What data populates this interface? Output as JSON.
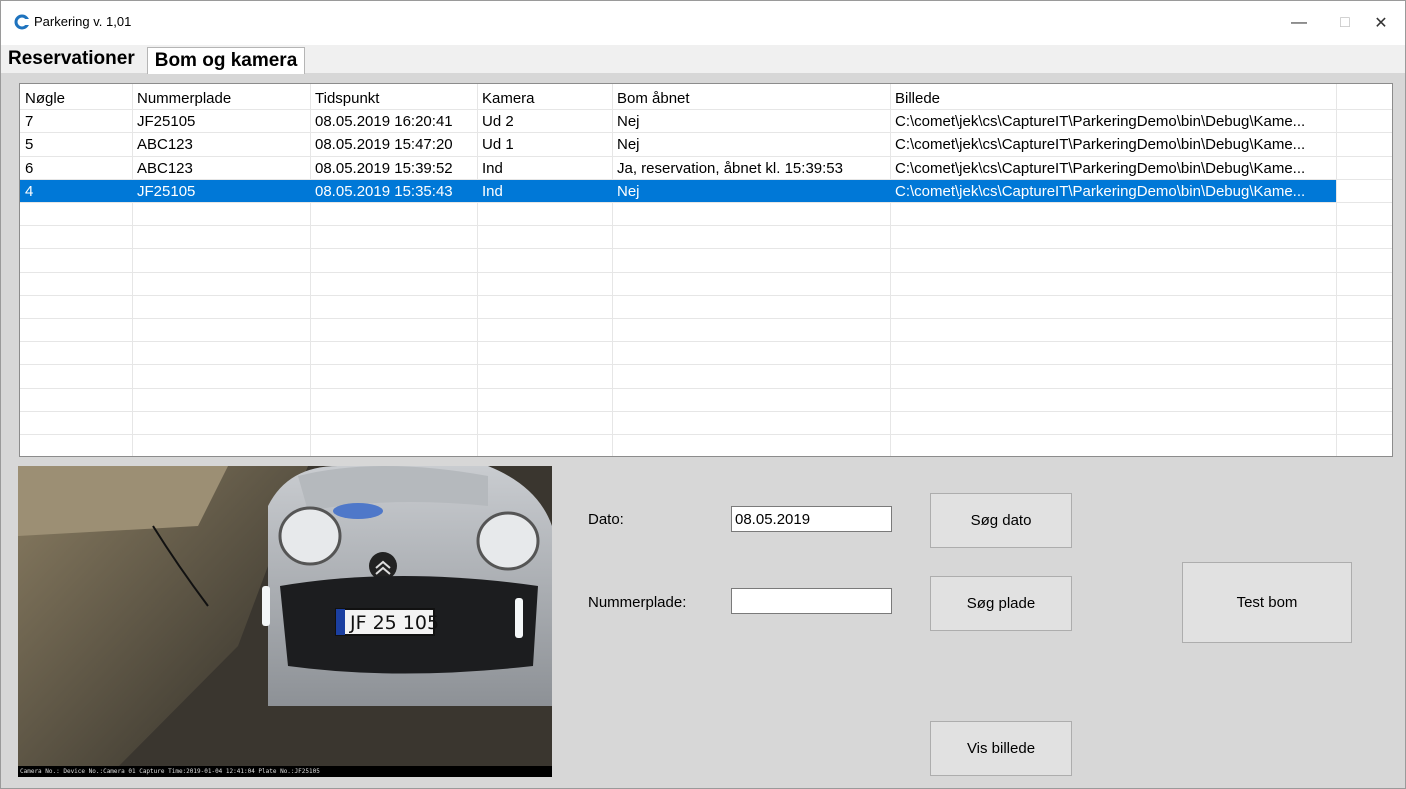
{
  "window": {
    "title": "Parkering v. 1,01",
    "min_glyph": "—",
    "max_glyph": "□",
    "close_glyph": "✕",
    "icon_letter": "C"
  },
  "tabs": [
    {
      "label": "Reservationer",
      "active": false
    },
    {
      "label": "Bom og kamera",
      "active": true
    }
  ],
  "grid": {
    "columns": [
      "Nøgle",
      "Nummerplade",
      "Tidspunkt",
      "Kamera",
      "Bom åbnet",
      "Billede"
    ],
    "rows": [
      [
        "7",
        "JF25105",
        "08.05.2019 16:20:41",
        "Ud 2",
        "Nej",
        "C:\\comet\\jek\\cs\\CaptureIT\\ParkeringDemo\\bin\\Debug\\Kame..."
      ],
      [
        "5",
        "ABC123",
        "08.05.2019 15:47:20",
        "Ud 1",
        "Nej",
        "C:\\comet\\jek\\cs\\CaptureIT\\ParkeringDemo\\bin\\Debug\\Kame..."
      ],
      [
        "6",
        "ABC123",
        "08.05.2019 15:39:52",
        "Ind",
        "Ja, reservation, åbnet kl. 15:39:53",
        "C:\\comet\\jek\\cs\\CaptureIT\\ParkeringDemo\\bin\\Debug\\Kame..."
      ],
      [
        "4",
        "JF25105",
        "08.05.2019 15:35:43",
        "Ind",
        "Nej",
        "C:\\comet\\jek\\cs\\CaptureIT\\ParkeringDemo\\bin\\Debug\\Kame..."
      ]
    ],
    "selected_row": 3
  },
  "camera": {
    "plate_text": "JF 25 105",
    "overlay_text": "Camera No.: Device No.:Camera 01 Capture Time:2019-01-04 12:41:04   Plate No.:JF25105"
  },
  "form": {
    "date_label": "Dato:",
    "date_value": "08.05.2019",
    "plate_label": "Nummerplade:",
    "plate_value": "",
    "search_date_button": "Søg dato",
    "search_plate_button": "Søg plade",
    "test_boom_button": "Test bom",
    "show_image_button": "Vis billede"
  },
  "colors": {
    "selection": "#0078d7",
    "accent_icon": "#1e73be"
  }
}
